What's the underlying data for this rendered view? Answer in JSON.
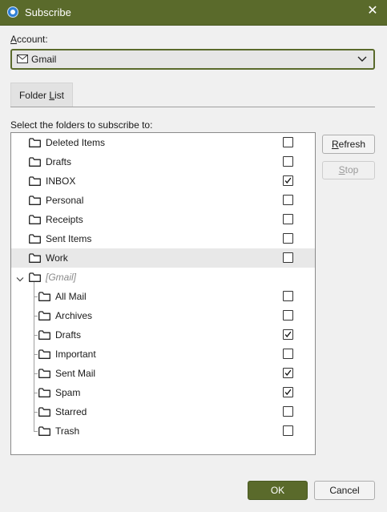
{
  "window": {
    "title": "Subscribe",
    "close_glyph": "✕"
  },
  "account": {
    "label_prefix": "A",
    "label_rest": "ccount:",
    "selected": "Gmail"
  },
  "tabs": [
    {
      "label_prefix": "Folder ",
      "label_accel": "L",
      "label_rest": "ist"
    }
  ],
  "instructions": "Select the folders to subscribe to:",
  "folders": [
    {
      "name": "Deleted Items",
      "checked": false,
      "highlighted": false
    },
    {
      "name": "Drafts",
      "checked": false,
      "highlighted": false
    },
    {
      "name": "INBOX",
      "checked": true,
      "highlighted": false
    },
    {
      "name": "Personal",
      "checked": false,
      "highlighted": false
    },
    {
      "name": "Receipts",
      "checked": false,
      "highlighted": false
    },
    {
      "name": "Sent Items",
      "checked": false,
      "highlighted": false
    },
    {
      "name": "Work",
      "checked": false,
      "highlighted": true
    }
  ],
  "gmail_group": {
    "name": "[Gmail]",
    "expanded": true,
    "children": [
      {
        "name": "All Mail",
        "checked": false
      },
      {
        "name": "Archives",
        "checked": false
      },
      {
        "name": "Drafts",
        "checked": true
      },
      {
        "name": "Important",
        "checked": false
      },
      {
        "name": "Sent Mail",
        "checked": true
      },
      {
        "name": "Spam",
        "checked": true
      },
      {
        "name": "Starred",
        "checked": false
      },
      {
        "name": "Trash",
        "checked": false
      }
    ]
  },
  "buttons": {
    "refresh_accel": "R",
    "refresh_rest": "efresh",
    "stop_accel": "S",
    "stop_rest": "top",
    "ok": "OK",
    "cancel": "Cancel"
  },
  "colors": {
    "accent": "#5a6a2b",
    "title_text": "#ffffff"
  },
  "icons": {
    "app": "app-icon",
    "folder": "folder-icon",
    "checkbox_check": "check-icon",
    "expander": "chevron-down-icon"
  }
}
